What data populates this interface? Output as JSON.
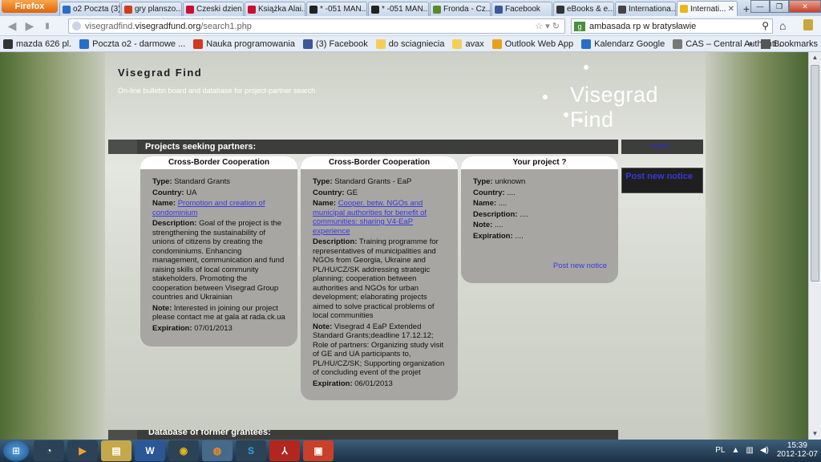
{
  "browser": {
    "firefox_label": "Firefox",
    "tabs": [
      {
        "label": "o2 Poczta (3)",
        "color": "#2a6cc9"
      },
      {
        "label": "gry planszo...",
        "color": "#d23a1a"
      },
      {
        "label": "Czeski dzien...",
        "color": "#c8102e"
      },
      {
        "label": "Książka Alai...",
        "color": "#c8102e"
      },
      {
        "label": "* -051 MAN...",
        "color": "#222222"
      },
      {
        "label": "* -051 MAN...",
        "color": "#222222"
      },
      {
        "label": "Fronda - Cz...",
        "color": "#5a8a2a"
      },
      {
        "label": "Facebook",
        "color": "#3b5998"
      },
      {
        "label": "eBooks & e...",
        "color": "#333333"
      },
      {
        "label": "Internationa...",
        "color": "#444444"
      },
      {
        "label": "Internati...",
        "color": "#e8b81a",
        "active": true
      }
    ],
    "url_prefix": "visegradfind.",
    "url_host": "visegradfund.org",
    "url_path": "/search1.php",
    "search_value": "ambasada rp w bratysławie",
    "bookmarks": [
      {
        "label": "mazda 626 pl.",
        "color": "#333333"
      },
      {
        "label": "Poczta o2 - darmowe ...",
        "color": "#2a6cc9"
      },
      {
        "label": "Nauka programowania",
        "color": "#d23a1a"
      },
      {
        "label": "(3) Facebook",
        "color": "#3b5998"
      },
      {
        "label": "do sciagniecia",
        "color": "#f3cf5a"
      },
      {
        "label": "avax",
        "color": "#f3cf5a"
      },
      {
        "label": "Outlook Web App",
        "color": "#e8a21a"
      },
      {
        "label": "Kalendarz Google",
        "color": "#2a6cc9"
      },
      {
        "label": "CAS – Central Authenti...",
        "color": "#777777"
      }
    ],
    "bookmarks_label": "Bookmarks"
  },
  "site": {
    "title": "Visegrad Find",
    "subtitle": "On-line bulletin board and database for project-partner search.",
    "logo_text": "Visegrad Find"
  },
  "section": {
    "heading": "Projects seeking partners:",
    "more_label": "more...",
    "post_new_notice_box": "Post new notice",
    "next_heading": "Database of former grantees:"
  },
  "cards": [
    {
      "header": "Cross-Border Cooperation",
      "type_label": "Type:",
      "type": "Standard Grants",
      "country_label": "Country:",
      "country": "UA",
      "name_label": "Name:",
      "name": "Promotion and creation of condominium",
      "description_label": "Description:",
      "description": "Goal of the project is the strengthening the sustainability of unions of citizens by creating the condominiums. Enhancing management, communication and fund raising skills of local community stakeholders. Promoting the cooperation between Visegrad Group countries and Ukrainian",
      "note_label": "Note:",
      "note": "Interested in joining our project please contact me at gala at rada.ck.ua",
      "expiration_label": "Expiration:",
      "expiration": "07/01/2013"
    },
    {
      "header": "Cross-Border Cooperation",
      "type_label": "Type:",
      "type": "Standard Grants - EaP",
      "country_label": "Country:",
      "country": "GE",
      "name_label": "Name:",
      "name": "Cooper. betw. NGOs and municipal authorities for benefit of communities: sharing V4-EaP experience",
      "description_label": "Description:",
      "description": "Training programme for representatives of municipalities and NGOs from Georgia, Ukraine and PL/HU/CZ/SK addressing strategic planning; cooperation between authorities and NGOs for urban development; elaborating projects aimed to solve practical problems of local communities",
      "note_label": "Note:",
      "note": "Visegrad 4 EaP Extended Standard Grants;deadline 17.12.12; Role of partners: Organizing study visit of GE and UA participants to, PL/HU/CZ/SK; Supporting organization of concluding event of the projet",
      "expiration_label": "Expiration:",
      "expiration": "06/01/2013"
    },
    {
      "header": "Your project ?",
      "type_label": "Type:",
      "type": "unknown",
      "country_label": "Country:",
      "country": "....",
      "name_label": "Name:",
      "name": "....",
      "description_label": "Description:",
      "description": "....",
      "note_label": "Note:",
      "note": "....",
      "expiration_label": "Expiration:",
      "expiration": "....",
      "post_link": "Post new notice"
    }
  ],
  "taskbar": {
    "language": "PL",
    "time": "15:39",
    "date": "2012-12-07"
  }
}
